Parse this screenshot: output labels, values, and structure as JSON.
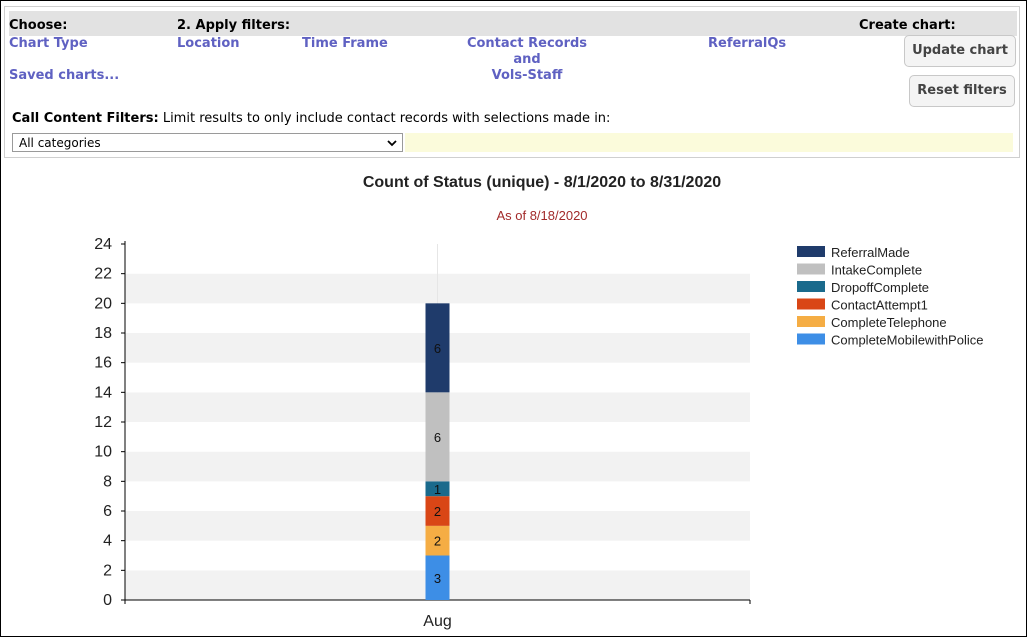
{
  "header": {
    "choose": "Choose:",
    "apply_filters": "2. Apply filters:",
    "create_chart": "Create chart:"
  },
  "nav": {
    "chart_type": "Chart Type",
    "saved_charts": "Saved charts...",
    "location": "Location",
    "time_frame": "Time Frame",
    "contact_records_line1": "Contact Records",
    "contact_records_line2": "and",
    "contact_records_line3": "Vols-Staff",
    "referralqs": "ReferralQs"
  },
  "buttons": {
    "update_chart": "Update chart",
    "reset_filters": "Reset filters"
  },
  "filters": {
    "label": "Call Content Filters:",
    "description": "Limit results to only include contact records with selections made in:",
    "category_select": "All categories"
  },
  "colors": {
    "ReferralMade": "#1f3b6b",
    "IntakeComplete": "#c0c0c0",
    "DropoffComplete": "#1a6a8c",
    "ContactAttempt1": "#d94616",
    "CompleteTelephone": "#f5ad44",
    "CompleteMobilewithPolice": "#3d8ee6"
  },
  "chart_data": {
    "type": "bar",
    "stacked": true,
    "title": "Count of Status (unique) - 8/1/2020 to 8/31/2020",
    "subtitle": "As of 8/18/2020",
    "categories": [
      "Aug"
    ],
    "ylim": [
      0,
      24
    ],
    "yticks": [
      0,
      2,
      4,
      6,
      8,
      10,
      12,
      14,
      16,
      18,
      20,
      22,
      24
    ],
    "legend_position": "right",
    "series": [
      {
        "name": "CompleteMobilewithPolice",
        "values": [
          3
        ],
        "color": "#3d8ee6"
      },
      {
        "name": "CompleteTelephone",
        "values": [
          2
        ],
        "color": "#f5ad44"
      },
      {
        "name": "ContactAttempt1",
        "values": [
          2
        ],
        "color": "#d94616"
      },
      {
        "name": "DropoffComplete",
        "values": [
          1
        ],
        "color": "#1a6a8c"
      },
      {
        "name": "IntakeComplete",
        "values": [
          6
        ],
        "color": "#c0c0c0"
      },
      {
        "name": "ReferralMade",
        "values": [
          6
        ],
        "color": "#1f3b6b"
      }
    ],
    "legend_order": [
      "ReferralMade",
      "IntakeComplete",
      "DropoffComplete",
      "ContactAttempt1",
      "CompleteTelephone",
      "CompleteMobilewithPolice"
    ]
  }
}
